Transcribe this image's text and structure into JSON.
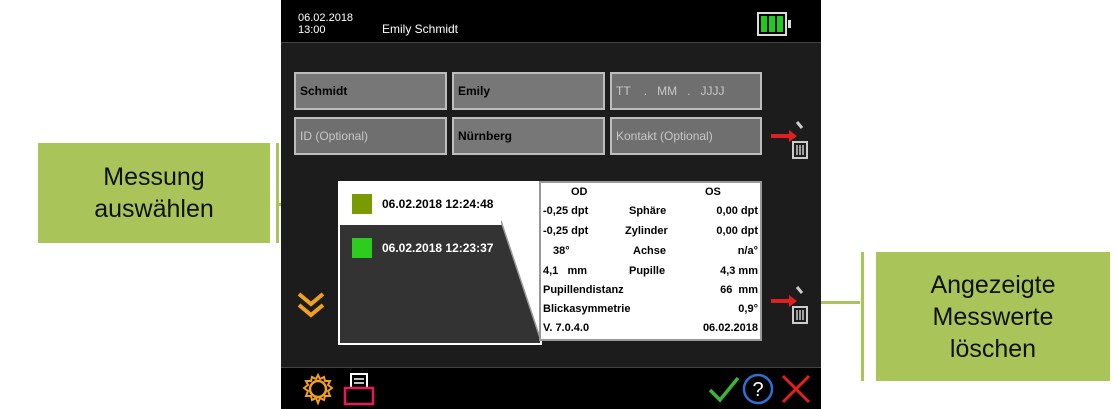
{
  "callouts": {
    "select_measurement": "Messung\nauswählen",
    "delete_values": "Angezeigte\nMesswerte\nlöschen"
  },
  "header": {
    "date": "06.02.2018",
    "time": "13:00",
    "patient_name": "Emily Schmidt",
    "battery_level": 3
  },
  "form": {
    "last_name": "Schmidt",
    "first_name": "Emily",
    "birthdate_placeholder": "TT    .   MM   .   JJJJ",
    "id_placeholder": "ID (Optional)",
    "city": "Nürnberg",
    "contact_placeholder": "Kontakt (Optional)"
  },
  "measurements": [
    {
      "label": "06.02.2018 12:24:48",
      "color": "#7a9a01",
      "selected": true
    },
    {
      "label": "06.02.2018 12:23:37",
      "color": "#2ecc1e",
      "selected": false
    }
  ],
  "panel": {
    "od": "OD",
    "os": "OS",
    "rows": [
      {
        "left": "-0,25 dpt",
        "label": "Sphäre",
        "right": "0,00  dpt"
      },
      {
        "left": "-0,25 dpt",
        "label": "Zylinder",
        "right": "0,00  dpt"
      },
      {
        "left": "38°",
        "label": "Achse",
        "right": "n/a°"
      },
      {
        "left": "4,1   mm",
        "label": "Pupille",
        "right": "4,3  mm"
      }
    ],
    "pd_label": "Pupillendistanz",
    "pd_value": "66  mm",
    "asym_label": "Blickasymmetrie",
    "asym_value": "0,9°",
    "version": "V. 7.0.4.0",
    "version_date": "06.02.2018"
  },
  "colors": {
    "accent_orange": "#f0a020",
    "delete_red": "#e02020",
    "confirm_green": "#3cb43c",
    "callout_green": "#a9c55a"
  },
  "icons": [
    "settings-icon",
    "print-icon",
    "confirm-icon",
    "help-icon",
    "cancel-icon",
    "delete-icon",
    "scroll-down-icon"
  ]
}
